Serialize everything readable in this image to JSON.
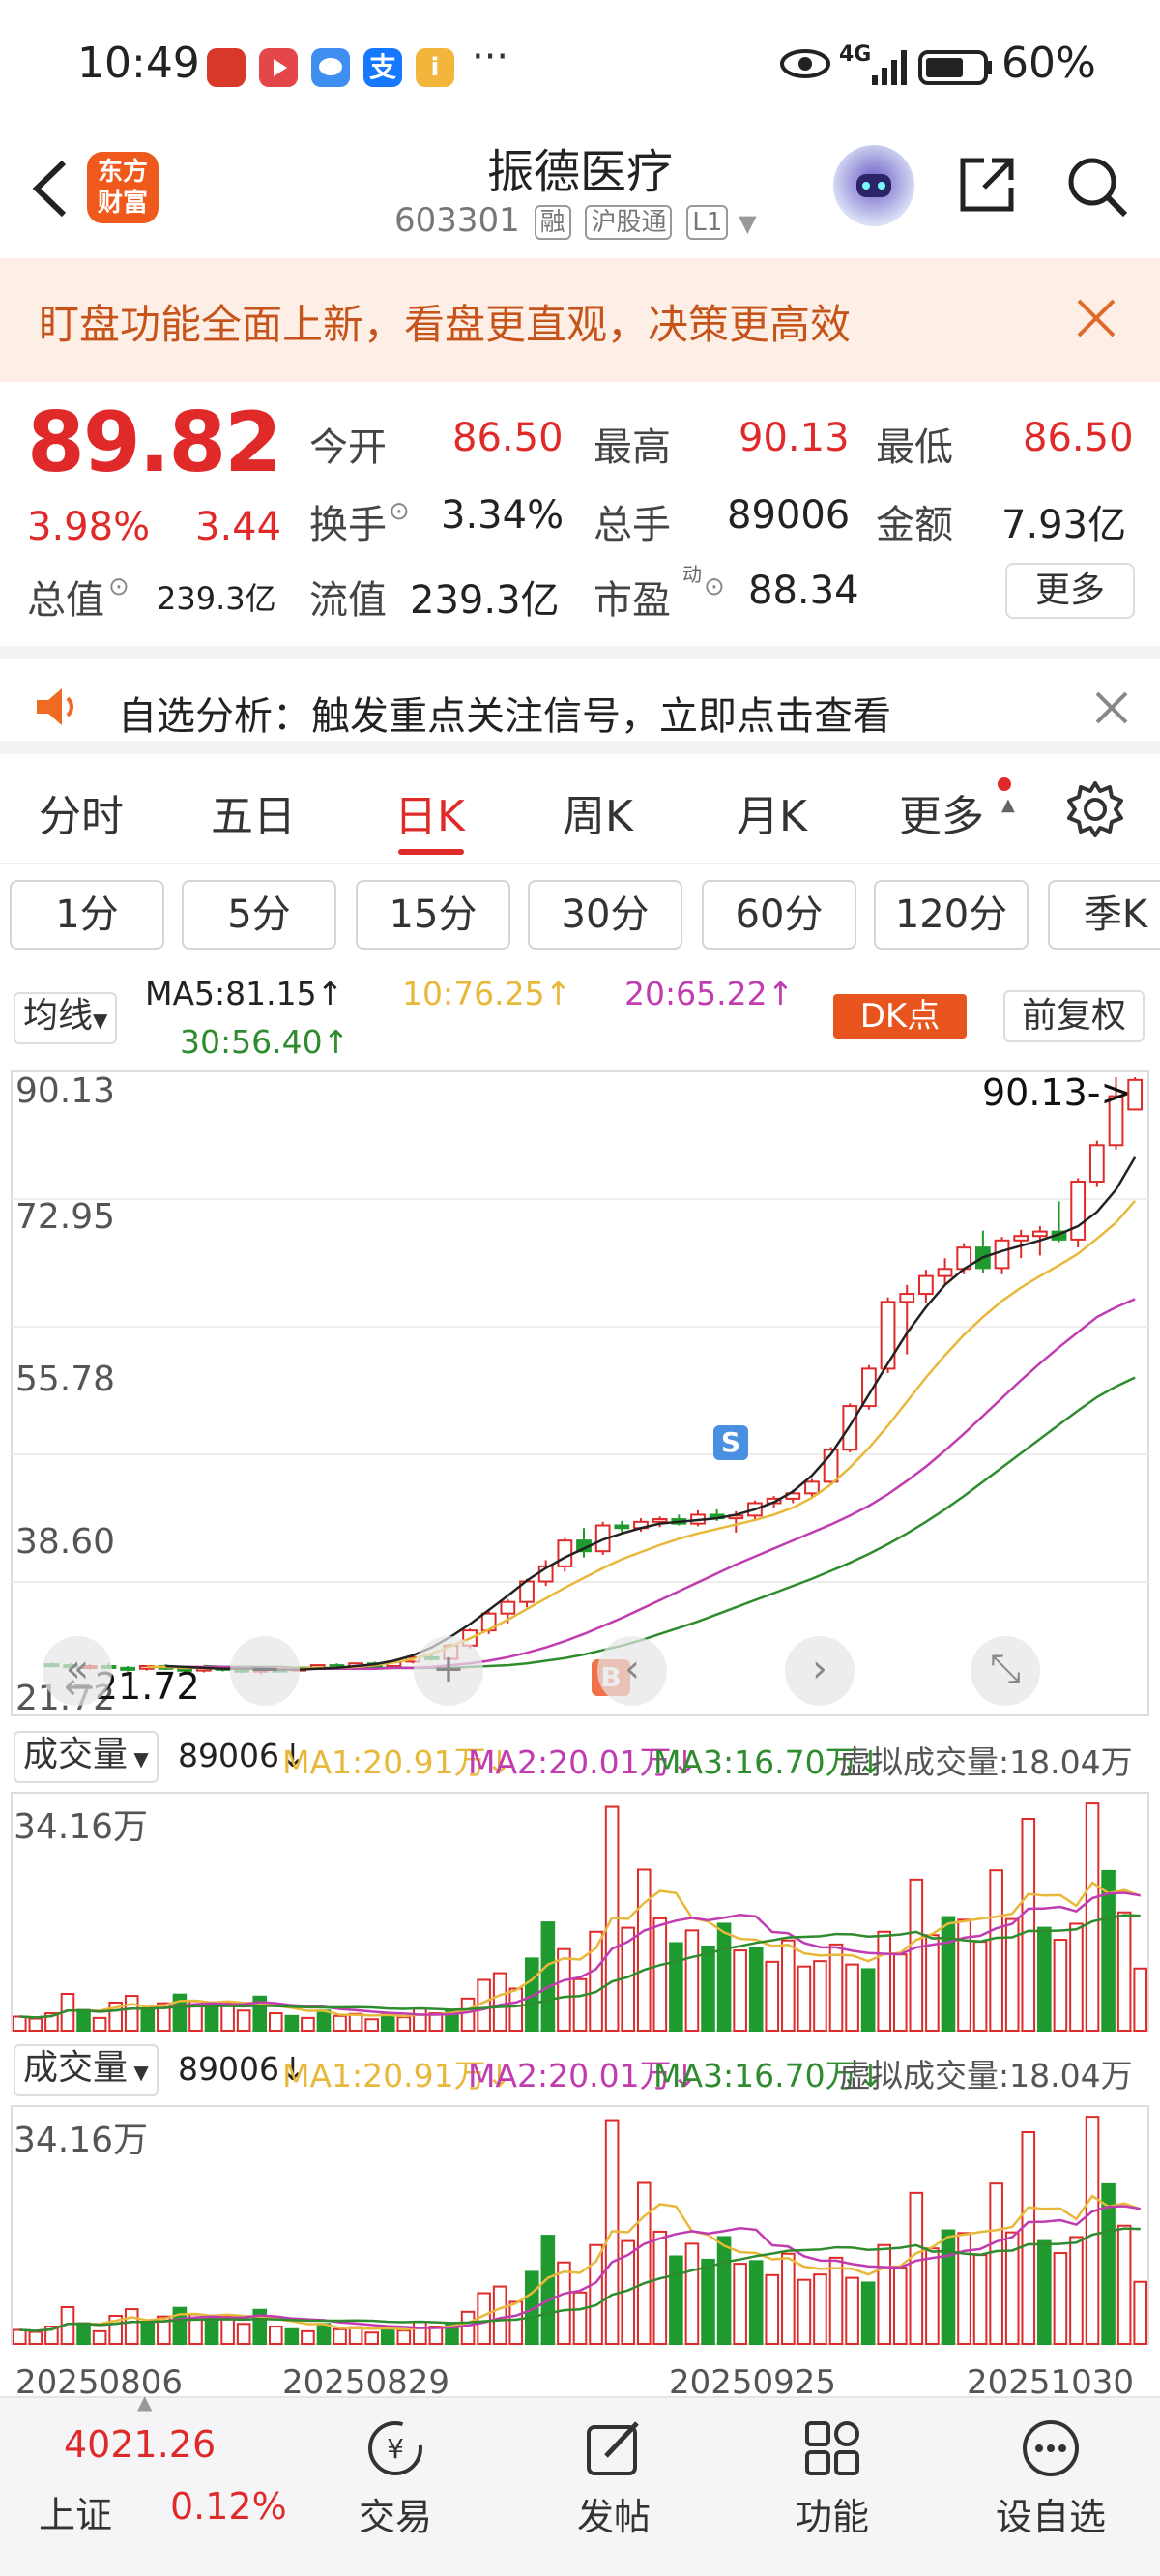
{
  "status": {
    "time": "10:49",
    "dots": "···",
    "network": "4G",
    "battery": "60%",
    "app_icons": [
      "cloud-store-icon",
      "video-icon",
      "message-icon",
      "alipay-icon",
      "info-icon"
    ]
  },
  "header": {
    "logo_line1": "东方",
    "logo_line2": "财富",
    "title": "振德医疗",
    "code": "603301",
    "tag_rong": "融",
    "tag_hgt": "沪股通",
    "tag_l1": "L1"
  },
  "banner": {
    "text": "盯盘功能全面上新，看盘更直观，决策更高效"
  },
  "quote": {
    "price": "89.82",
    "change_pct": "3.98%",
    "change": "3.44",
    "open_label": "今开",
    "open": "86.50",
    "high_label": "最高",
    "high": "90.13",
    "low_label": "最低",
    "low": "86.50",
    "turnover_label": "换手",
    "turnover": "3.34%",
    "volume_label": "总手",
    "volume": "89006",
    "amount_label": "金额",
    "amount": "7.93亿",
    "mktcap_label": "总值",
    "mktcap": "239.3亿",
    "float_label": "流值",
    "float": "239.3亿",
    "pe_label": "市盈",
    "pe_sup": "动",
    "pe": "88.34",
    "more": "更多"
  },
  "notice": {
    "text": "自选分析：触发重点关注信号，立即点击查看"
  },
  "tabs": [
    "分时",
    "五日",
    "日K",
    "周K",
    "月K",
    "更多"
  ],
  "periods": [
    "1分",
    "5分",
    "15分",
    "30分",
    "60分",
    "120分",
    "季K"
  ],
  "ma_row": {
    "select": "均线",
    "ma5": "MA5:81.15↑",
    "ma10": "10:76.25↑",
    "ma20": "20:65.22↑",
    "ma30": "30:56.40↑",
    "dk": "DK点",
    "fq": "前复权"
  },
  "vol_row": {
    "select": "成交量",
    "vol": "89006↓",
    "ma1": "MA1:20.91万↓",
    "ma2": "MA2:20.01万↓",
    "ma3": "MA3:16.70万↓",
    "virtual": "虚拟成交量:18.04万",
    "max_label": "34.16万"
  },
  "colors": {
    "up": "#e02a2a",
    "down": "#1f9a2e",
    "ma5": "#222222",
    "ma10": "#e8b83a",
    "ma20": "#c03cb0",
    "ma30": "#2e8b2e",
    "accent": "#e8541d"
  },
  "chart_data": [
    {
      "type": "candlestick",
      "y_ticks": [
        "90.13",
        "72.95",
        "55.78",
        "38.60",
        "21.72"
      ],
      "ylim": [
        21.72,
        90.13
      ],
      "annotations": {
        "high_label": "90.13->",
        "low_label": "←21.72",
        "sell_marker": "S",
        "buy_marker": "B"
      },
      "candles": [
        [
          24.2,
          24.4,
          23.9,
          24.1
        ],
        [
          24.1,
          24.3,
          23.8,
          23.9
        ],
        [
          23.9,
          24.2,
          23.6,
          24.0
        ],
        [
          24.0,
          24.3,
          23.7,
          23.8
        ],
        [
          23.8,
          24.0,
          23.4,
          23.7
        ],
        [
          23.7,
          24.1,
          23.5,
          24.0
        ],
        [
          24.0,
          24.2,
          23.6,
          23.7
        ],
        [
          23.7,
          23.9,
          23.3,
          23.5
        ],
        [
          23.5,
          23.9,
          23.3,
          23.8
        ],
        [
          23.8,
          24.0,
          23.4,
          23.6
        ],
        [
          23.6,
          23.8,
          23.2,
          23.4
        ],
        [
          23.4,
          23.7,
          23.1,
          23.6
        ],
        [
          23.6,
          23.8,
          23.3,
          23.5
        ],
        [
          23.5,
          23.9,
          23.4,
          23.8
        ],
        [
          23.8,
          24.2,
          23.6,
          24.1
        ],
        [
          24.1,
          24.3,
          23.8,
          23.9
        ],
        [
          23.9,
          24.4,
          23.8,
          24.3
        ],
        [
          24.3,
          24.5,
          23.9,
          24.0
        ],
        [
          24.0,
          24.6,
          23.9,
          24.5
        ],
        [
          24.5,
          25.2,
          24.3,
          25.0
        ],
        [
          25.0,
          25.4,
          24.6,
          24.8
        ],
        [
          24.8,
          26.5,
          24.7,
          26.3
        ],
        [
          26.3,
          28.2,
          26.0,
          28.0
        ],
        [
          28.0,
          30.2,
          27.6,
          29.9
        ],
        [
          29.9,
          31.5,
          28.8,
          31.2
        ],
        [
          31.2,
          33.8,
          30.6,
          33.5
        ],
        [
          33.5,
          35.9,
          33.0,
          35.2
        ],
        [
          35.2,
          38.4,
          34.6,
          38.1
        ],
        [
          38.1,
          39.5,
          36.2,
          36.9
        ],
        [
          36.9,
          40.2,
          36.5,
          39.8
        ],
        [
          39.8,
          40.3,
          38.9,
          39.5
        ],
        [
          39.5,
          40.6,
          39.1,
          40.2
        ],
        [
          40.2,
          40.8,
          39.6,
          40.5
        ],
        [
          40.5,
          41.0,
          39.8,
          40.0
        ],
        [
          40.0,
          41.5,
          39.7,
          41.0
        ],
        [
          41.0,
          41.6,
          40.3,
          40.6
        ],
        [
          40.6,
          41.4,
          39.0,
          40.9
        ],
        [
          40.9,
          42.6,
          40.5,
          42.3
        ],
        [
          42.3,
          43.1,
          41.8,
          42.8
        ],
        [
          42.8,
          43.8,
          42.3,
          43.4
        ],
        [
          43.4,
          45.0,
          43.0,
          44.7
        ],
        [
          44.7,
          48.6,
          44.4,
          48.3
        ],
        [
          48.3,
          53.5,
          48.0,
          53.2
        ],
        [
          53.2,
          57.8,
          52.8,
          57.4
        ],
        [
          57.4,
          65.4,
          56.9,
          64.9
        ],
        [
          64.9,
          66.8,
          59.0,
          65.8
        ],
        [
          65.8,
          68.5,
          64.8,
          67.8
        ],
        [
          67.8,
          69.8,
          66.9,
          68.6
        ],
        [
          68.6,
          71.5,
          68.0,
          71.0
        ],
        [
          71.0,
          72.9,
          68.2,
          68.7
        ],
        [
          68.7,
          72.2,
          68.0,
          71.8
        ],
        [
          71.8,
          73.0,
          69.8,
          72.3
        ],
        [
          72.3,
          73.4,
          70.1,
          72.8
        ],
        [
          72.8,
          76.2,
          71.6,
          71.9
        ],
        [
          71.9,
          78.8,
          71.0,
          78.4
        ],
        [
          78.4,
          83.0,
          77.8,
          82.5
        ],
        [
          82.5,
          90.13,
          82.0,
          88.0
        ],
        [
          86.5,
          90.13,
          86.5,
          89.82
        ]
      ],
      "ma_series": {
        "ma5": [
          24.0,
          23.9,
          23.8,
          23.7,
          23.7,
          23.7,
          23.6,
          23.6,
          23.7,
          23.8,
          24.0,
          24.2,
          24.6,
          25.2,
          26.1,
          27.3,
          28.7,
          30.3,
          31.9,
          33.6,
          35.0,
          36.2,
          37.2,
          38.2,
          38.9,
          39.5,
          40.0,
          40.2,
          40.4,
          40.6,
          41.0,
          41.6,
          42.4,
          43.6,
          45.4,
          47.8,
          51.0,
          54.5,
          58.0,
          61.4,
          64.3,
          66.8,
          68.6,
          69.9,
          70.6,
          71.2,
          71.8,
          72.5,
          73.4,
          75.0,
          77.5,
          81.15
        ],
        "ma10": [
          23.9,
          23.9,
          23.8,
          23.8,
          23.7,
          23.7,
          23.7,
          23.7,
          23.7,
          23.8,
          23.8,
          23.9,
          24.1,
          24.4,
          24.8,
          25.4,
          26.2,
          27.1,
          28.1,
          29.2,
          30.4,
          31.6,
          32.8,
          33.9,
          35.0,
          36.0,
          36.8,
          37.6,
          38.3,
          38.9,
          39.4,
          39.9,
          40.4,
          41.0,
          41.8,
          42.9,
          44.4,
          46.3,
          48.5,
          51.0,
          53.7,
          56.4,
          58.9,
          61.2,
          63.2,
          65.0,
          66.5,
          67.8,
          69.0,
          70.3,
          72.0,
          73.8,
          76.25
        ],
        "ma20": [
          23.9,
          23.9,
          23.9,
          23.8,
          23.8,
          23.8,
          23.7,
          23.7,
          23.7,
          23.7,
          23.7,
          23.8,
          23.8,
          23.9,
          24.1,
          24.3,
          24.6,
          25.0,
          25.5,
          26.1,
          26.8,
          27.6,
          28.5,
          29.4,
          30.4,
          31.4,
          32.4,
          33.4,
          34.4,
          35.4,
          36.3,
          37.2,
          38.1,
          39.0,
          39.9,
          40.9,
          42.0,
          43.3,
          44.8,
          46.4,
          48.2,
          50.1,
          52.1,
          54.1,
          56.1,
          58.0,
          59.8,
          61.5,
          63.2,
          64.3,
          65.22
        ],
        "ma30": [
          24.0,
          23.9,
          23.9,
          23.9,
          23.9,
          23.8,
          23.8,
          23.8,
          23.8,
          23.8,
          23.8,
          23.8,
          23.8,
          23.8,
          23.9,
          24.0,
          24.1,
          24.3,
          24.6,
          24.9,
          25.3,
          25.8,
          26.3,
          26.9,
          27.6,
          28.3,
          29.0,
          29.8,
          30.6,
          31.4,
          32.2,
          33.0,
          33.8,
          34.7,
          35.6,
          36.6,
          37.7,
          38.9,
          40.2,
          41.6,
          43.1,
          44.7,
          46.3,
          47.9,
          49.5,
          51.1,
          52.7,
          54.2,
          55.4,
          56.4
        ]
      }
    },
    {
      "type": "bar",
      "title": "成交量",
      "ylim": [
        0,
        34.16
      ],
      "unit": "万",
      "values": [
        2.1,
        1.8,
        2.6,
        5.5,
        3.1,
        1.9,
        4.2,
        5.2,
        3.3,
        4.1,
        5.4,
        4.4,
        3.8,
        4.2,
        3.0,
        5.1,
        2.6,
        2.2,
        1.9,
        3.0,
        2.2,
        2.5,
        1.7,
        2.4,
        2.0,
        3.3,
        2.6,
        3.0,
        4.8,
        7.6,
        8.6,
        6.3,
        10.8,
        16.2,
        12.2,
        7.7,
        14.8,
        33.5,
        15.4,
        24.1,
        16.8,
        13.1,
        15.0,
        12.6,
        16.0,
        12.0,
        12.4,
        10.3,
        13.5,
        9.6,
        10.4,
        12.9,
        9.9,
        9.2,
        14.8,
        11.4,
        22.6,
        14.3,
        17.0,
        16.6,
        13.3,
        24.0,
        16.7,
        31.7,
        15.4,
        13.6,
        16.0,
        34.0,
        23.9,
        17.7,
        9.3
      ],
      "up_flags": [
        1,
        1,
        1,
        1,
        0,
        1,
        1,
        1,
        0,
        1,
        0,
        1,
        0,
        1,
        1,
        0,
        1,
        0,
        1,
        0,
        1,
        1,
        1,
        0,
        1,
        1,
        1,
        0,
        1,
        1,
        1,
        1,
        0,
        0,
        1,
        1,
        1,
        1,
        1,
        1,
        1,
        0,
        1,
        0,
        0,
        1,
        0,
        1,
        1,
        1,
        1,
        1,
        1,
        0,
        1,
        1,
        1,
        1,
        0,
        1,
        1,
        1,
        1,
        1,
        0,
        1,
        1,
        1,
        0,
        1,
        1
      ]
    }
  ],
  "x_labels": [
    "20250806",
    "20250829",
    "20250925",
    "20251030"
  ],
  "bottom": {
    "index_value": "4021.26",
    "index_name": "上证",
    "index_change": "0.12%",
    "nav": [
      "交易",
      "发帖",
      "功能",
      "设自选"
    ]
  }
}
